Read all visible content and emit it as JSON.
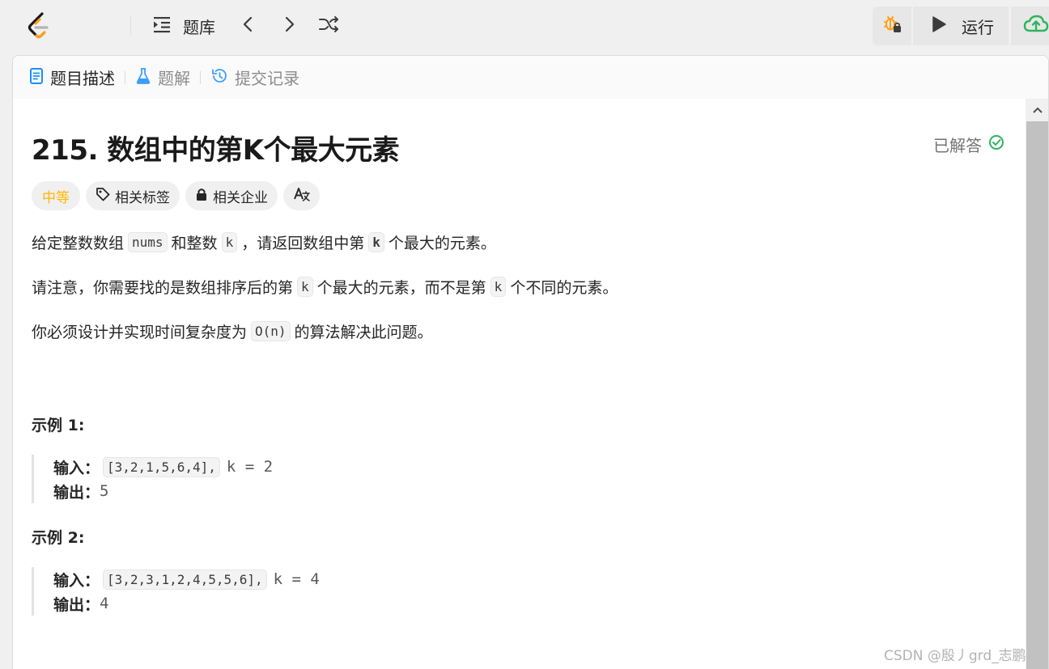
{
  "nav": {
    "problems_label": "题库",
    "run_label": "运行"
  },
  "tabs": [
    {
      "label": "题目描述"
    },
    {
      "label": "题解"
    },
    {
      "label": "提交记录"
    }
  ],
  "problem": {
    "title": "215. 数组中的第K个最大元素",
    "status": "已解答",
    "difficulty": "中等",
    "tag_related": "相关标签",
    "tag_companies": "相关企业",
    "tag_lang": "A文",
    "desc1": {
      "a": "给定整数数组",
      "c1": "nums",
      "b": "和整数",
      "c2": "k",
      "c": "，请返回数组中第",
      "c3": "k",
      "d": "个最大的元素。"
    },
    "desc2": {
      "a": "请注意，你需要找的是数组排序后的第",
      "c1": "k",
      "b": "个最大的元素，而不是第",
      "c2": "k",
      "c": "个不同的元素。"
    },
    "desc3": {
      "a": "你必须设计并实现时间复杂度为",
      "c1": "O(n)",
      "b": "的算法解决此问题。"
    }
  },
  "examples": [
    {
      "title": "示例 1:",
      "input_label": "输入：",
      "input_code": "[3,2,1,5,6,4],",
      "input_rest": "k = 2",
      "output_label": "输出：",
      "output": "5"
    },
    {
      "title": "示例 2:",
      "input_label": "输入：",
      "input_code": "[3,2,3,1,2,4,5,5,6],",
      "input_rest": "k = 4",
      "output_label": "输出：",
      "output": "4"
    }
  ],
  "watermark": "CSDN @殷丿grd_志鹏",
  "colors": {
    "difficulty": "#ffb800",
    "solved_check": "#2db55d",
    "submit_cloud": "#2db55d",
    "tab_active_icon": "#1a90ff"
  }
}
